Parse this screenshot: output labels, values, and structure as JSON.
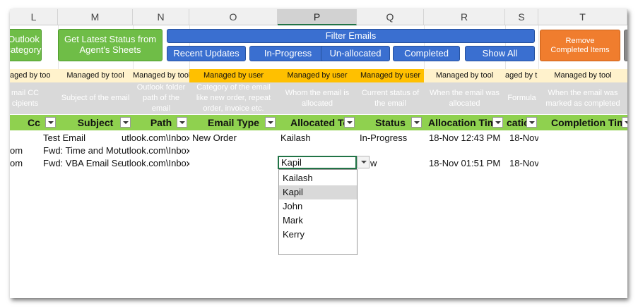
{
  "columns": [
    "L",
    "M",
    "N",
    "O",
    "P",
    "Q",
    "R",
    "S",
    "T"
  ],
  "buttons": {
    "outlook_category": "Outlook\ncategory",
    "latest_status": "Get Latest Status from Agent's Sheets",
    "filter_emails": "Filter Emails",
    "recent_updates": "Recent Updates",
    "in_progress": "In-Progress",
    "un_allocated": "Un-allocated",
    "completed": "Completed",
    "show_all": "Show All",
    "remove_completed": "Remove Completed Items"
  },
  "managed": {
    "l": "aged by too",
    "m": "Managed by tool",
    "n": "Managed by tool",
    "o": "Managed by user",
    "p": "Managed by user",
    "q": "Managed by user",
    "r": "Managed by tool",
    "s": "aged by t",
    "t": "Managed by tool"
  },
  "descriptions": {
    "l": "mail CC\ncipients",
    "m": "Subject of the email",
    "n": "Outlook folder path of the email",
    "o": "Category of the email like new order, repeat order, invoice etc.",
    "p": "Whom the email is allocated",
    "q": "Current status of the email",
    "r": "When the email was allocated",
    "s": "Formula",
    "t": "When the email was marked as completed"
  },
  "headers": {
    "cc": "Cc",
    "subject": "Subject",
    "path": "Path",
    "email_type": "Email Type",
    "allocated_to": "Allocated To",
    "status": "Status",
    "allocation_time": "Allocation Time",
    "s": "catio",
    "completion_time": "Completion Time"
  },
  "rows": [
    {
      "l": "",
      "subject": "Test Email",
      "path": "utlook.com\\Inbox",
      "email_type": "New Order",
      "allocated": "Kailash",
      "status": "In-Progress",
      "alloc_time": "18-Nov 12:43 PM",
      "s": "18-Nov"
    },
    {
      "l": "om",
      "subject": "Fwd: Time and Moti",
      "path": "utlook.com\\Inbox",
      "email_type": "",
      "allocated": "",
      "status": "",
      "alloc_time": "",
      "s": ""
    },
    {
      "l": "om",
      "subject": "Fwd: VBA Email Sen",
      "path": "utlook.com\\Inbox",
      "email_type": "",
      "allocated": "Kapil",
      "status": "w",
      "alloc_time": "18-Nov 01:51 PM",
      "s": "18-Nov"
    }
  ],
  "dropdown": {
    "selected": "Kapil",
    "options": [
      "Kailash",
      "Kapil",
      "John",
      "Mark",
      "Kerry"
    ]
  },
  "colors": {
    "header_green": "#8fd14f",
    "managed_user_bg": "#ffc000",
    "managed_tool_bg": "#fff2cc",
    "description_bg": "#d9d9d9",
    "button_green": "#6fbd47",
    "button_blue": "#3a6fd0",
    "button_orange": "#f07d2e",
    "selection_border": "#217346"
  }
}
